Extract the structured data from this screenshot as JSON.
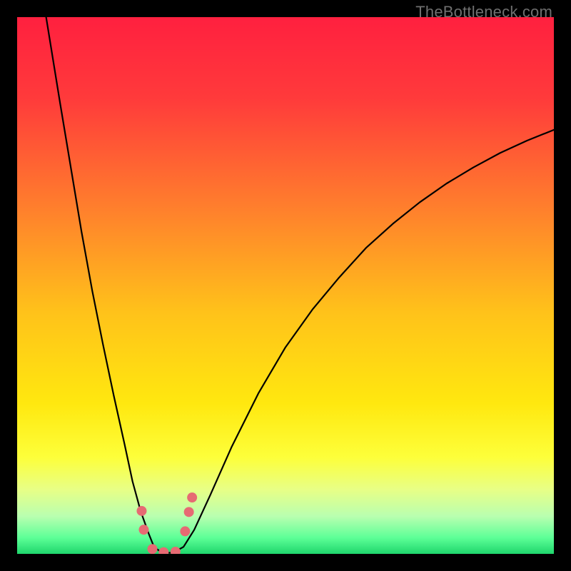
{
  "watermark": "TheBottleneck.com",
  "gradient": {
    "stops": [
      {
        "offset": 0.0,
        "color": "#ff203f"
      },
      {
        "offset": 0.15,
        "color": "#ff3a3b"
      },
      {
        "offset": 0.35,
        "color": "#ff7d2d"
      },
      {
        "offset": 0.55,
        "color": "#ffc21a"
      },
      {
        "offset": 0.72,
        "color": "#ffe80f"
      },
      {
        "offset": 0.82,
        "color": "#fdff3a"
      },
      {
        "offset": 0.88,
        "color": "#e8ff86"
      },
      {
        "offset": 0.93,
        "color": "#b9ffb0"
      },
      {
        "offset": 0.97,
        "color": "#5dff97"
      },
      {
        "offset": 1.0,
        "color": "#1fd66c"
      }
    ]
  },
  "chart_data": {
    "type": "line",
    "title": "",
    "xlabel": "",
    "ylabel": "",
    "xlim": [
      0,
      100
    ],
    "ylim": [
      0,
      100
    ],
    "x": [
      5.4,
      8,
      10,
      12,
      14,
      16,
      18,
      20,
      21.5,
      23,
      24.5,
      25.5,
      27,
      29,
      31,
      33,
      36,
      40,
      45,
      50,
      55,
      60,
      65,
      70,
      75,
      80,
      85,
      90,
      95,
      100
    ],
    "y": [
      100,
      84,
      72,
      60,
      49,
      39,
      29.5,
      20.5,
      13.5,
      8,
      3.8,
      1.3,
      0.2,
      0.2,
      1.3,
      4.5,
      11,
      20,
      30,
      38.5,
      45.5,
      51.5,
      57,
      61.5,
      65.5,
      69,
      72,
      74.7,
      77,
      79
    ],
    "markers": {
      "x": [
        23.2,
        23.6,
        25.2,
        27.3,
        29.5,
        31.3,
        32.0,
        32.6
      ],
      "y": [
        8.0,
        4.5,
        0.9,
        0.3,
        0.4,
        4.2,
        7.8,
        10.5
      ]
    },
    "marker_color": "#e66a73",
    "line_color": "#000000"
  }
}
